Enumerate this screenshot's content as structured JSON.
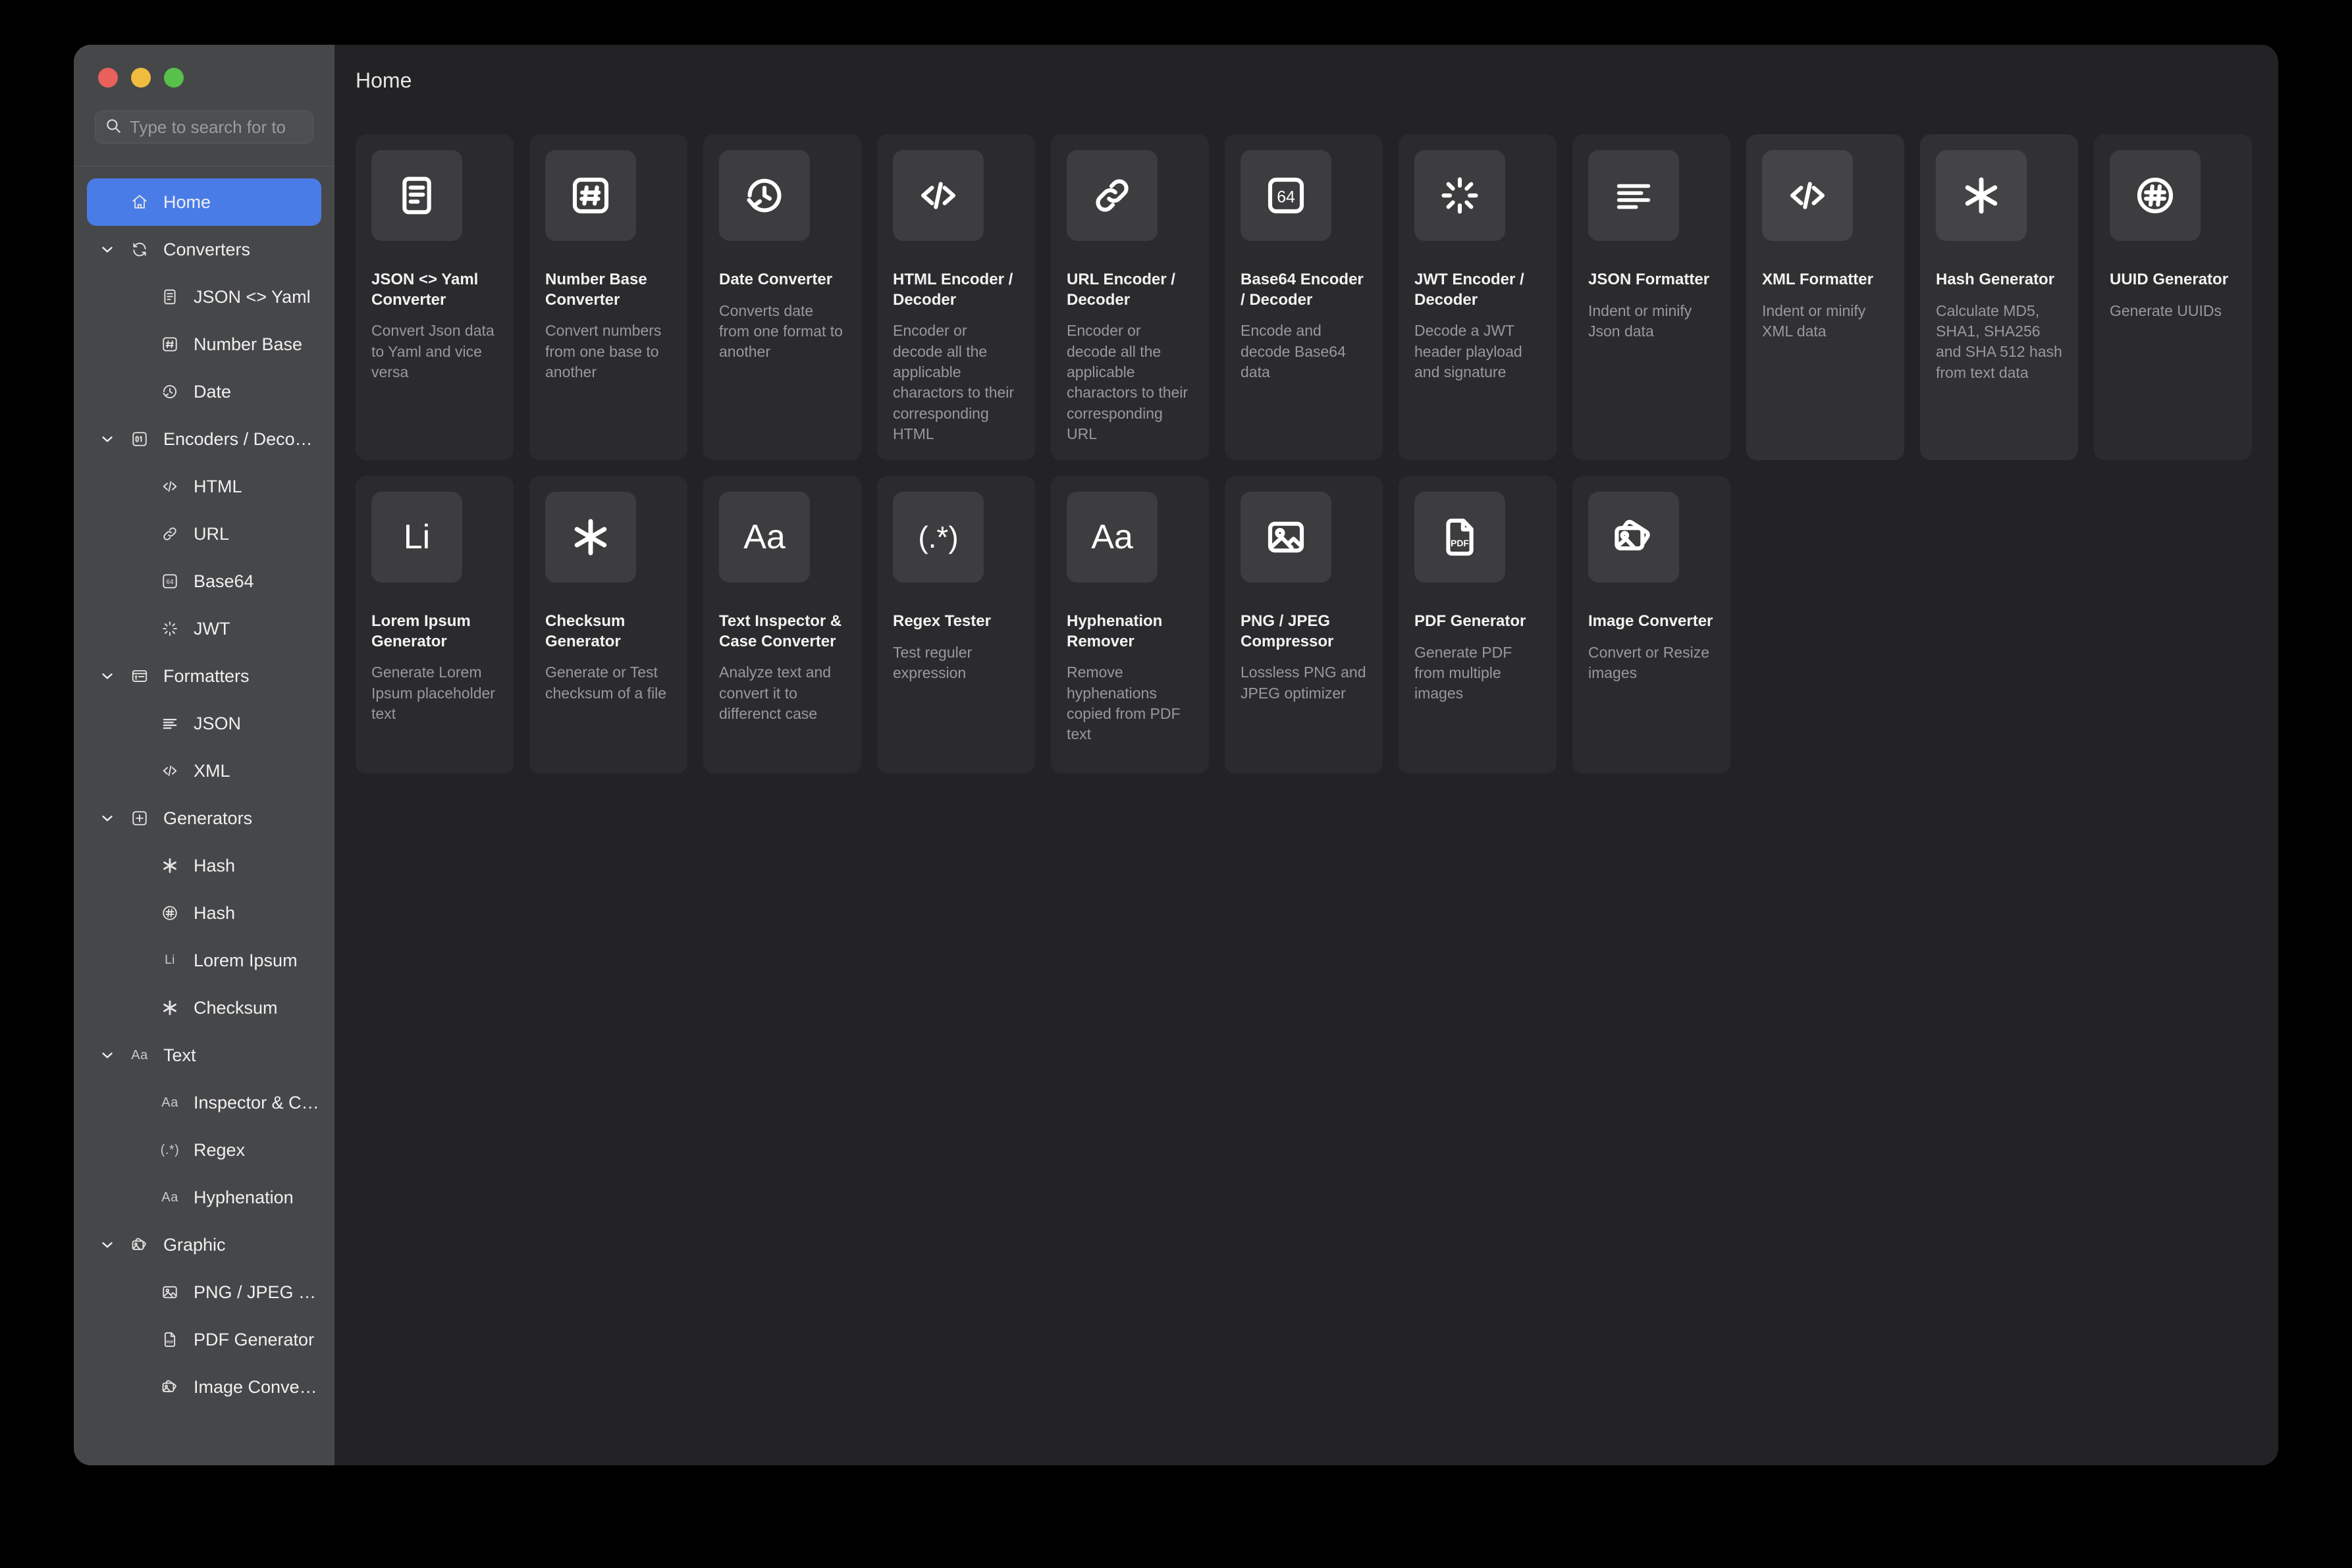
{
  "window": {
    "traffic_lights": [
      "close",
      "minimize",
      "maximize"
    ],
    "colors": {
      "accent": "#4a7ce8",
      "sidebar_bg": "#464749",
      "main_bg": "#232325",
      "card_bg": "#2b2b2d",
      "card_hover_bg": "#313133",
      "icon_tile_bg": "#3d3d3f",
      "close": "#e8615a",
      "minimize": "#f0bc3f",
      "maximize": "#57c14b"
    }
  },
  "search": {
    "placeholder": "Type to search for to",
    "value": "",
    "icon": "search-icon"
  },
  "sidebar": {
    "items": [
      {
        "label": "Home",
        "icon": "home-icon",
        "level": 0,
        "active": true,
        "expandable": false
      },
      {
        "label": "Converters",
        "icon": "refresh-icon",
        "level": 0,
        "active": false,
        "expandable": true,
        "expanded": true
      },
      {
        "label": "JSON <> Yaml",
        "icon": "document-icon",
        "level": 1,
        "active": false,
        "expandable": false
      },
      {
        "label": "Number Base",
        "icon": "hash-box-icon",
        "level": 1,
        "active": false,
        "expandable": false
      },
      {
        "label": "Date",
        "icon": "clock-rotate-icon",
        "level": 1,
        "active": false,
        "expandable": false
      },
      {
        "label": "Encoders / Decoders",
        "icon": "binary-box-icon",
        "level": 0,
        "active": false,
        "expandable": true,
        "expanded": true
      },
      {
        "label": "HTML",
        "icon": "code-icon",
        "level": 1,
        "active": false,
        "expandable": false
      },
      {
        "label": "URL",
        "icon": "link-icon",
        "level": 1,
        "active": false,
        "expandable": false
      },
      {
        "label": "Base64",
        "icon": "base64-box-icon",
        "level": 1,
        "active": false,
        "expandable": false
      },
      {
        "label": "JWT",
        "icon": "spinner-icon",
        "level": 1,
        "active": false,
        "expandable": false
      },
      {
        "label": "Formatters",
        "icon": "panel-list-icon",
        "level": 0,
        "active": false,
        "expandable": true,
        "expanded": true
      },
      {
        "label": "JSON",
        "icon": "align-left-icon",
        "level": 1,
        "active": false,
        "expandable": false
      },
      {
        "label": "XML",
        "icon": "code-icon",
        "level": 1,
        "active": false,
        "expandable": false
      },
      {
        "label": "Generators",
        "icon": "plus-box-icon",
        "level": 0,
        "active": false,
        "expandable": true,
        "expanded": true
      },
      {
        "label": "Hash",
        "icon": "asterisk-icon",
        "level": 1,
        "active": false,
        "expandable": false
      },
      {
        "label": "Hash",
        "icon": "hash-circle-icon",
        "level": 1,
        "active": false,
        "expandable": false
      },
      {
        "label": "Lorem Ipsum",
        "icon": "li-text-icon",
        "level": 1,
        "active": false,
        "expandable": false
      },
      {
        "label": "Checksum",
        "icon": "asterisk-icon",
        "level": 1,
        "active": false,
        "expandable": false
      },
      {
        "label": "Text",
        "icon": "aa-text-icon",
        "level": 0,
        "active": false,
        "expandable": true,
        "expanded": true
      },
      {
        "label": "Inspector & Case C...",
        "icon": "aa-text-icon",
        "level": 1,
        "active": false,
        "expandable": false
      },
      {
        "label": "Regex",
        "icon": "regex-icon",
        "level": 1,
        "active": false,
        "expandable": false
      },
      {
        "label": "Hyphenation",
        "icon": "aa-text-icon",
        "level": 1,
        "active": false,
        "expandable": false
      },
      {
        "label": "Graphic",
        "icon": "images-icon",
        "level": 0,
        "active": false,
        "expandable": true,
        "expanded": true
      },
      {
        "label": "PNG / JPEG Compr...",
        "icon": "image-icon",
        "level": 1,
        "active": false,
        "expandable": false
      },
      {
        "label": "PDF Generator",
        "icon": "pdf-file-icon",
        "level": 1,
        "active": false,
        "expandable": false
      },
      {
        "label": "Image Converter",
        "icon": "images-icon",
        "level": 1,
        "active": false,
        "expandable": false
      }
    ]
  },
  "main": {
    "title": "Home",
    "cards": [
      {
        "title": "JSON <> Yaml Converter",
        "desc": "Convert Json data to Yaml and vice versa",
        "icon": "document-icon",
        "hover": false
      },
      {
        "title": "Number Base Converter",
        "desc": "Convert numbers from one base to another",
        "icon": "hash-box-icon",
        "hover": false
      },
      {
        "title": "Date Converter",
        "desc": "Converts date from one format to another",
        "icon": "clock-rotate-icon",
        "hover": false
      },
      {
        "title": "HTML Encoder / Decoder",
        "desc": "Encoder or decode all the applicable charactors to their corresponding HTML",
        "icon": "code-icon",
        "hover": false
      },
      {
        "title": "URL Encoder / Decoder",
        "desc": "Encoder or decode all the applicable charactors to their corresponding URL",
        "icon": "link-icon",
        "hover": false
      },
      {
        "title": "Base64 Encoder / Decoder",
        "desc": "Encode and decode Base64 data",
        "icon": "base64-box-icon",
        "hover": false
      },
      {
        "title": "JWT Encoder / Decoder",
        "desc": "Decode a JWT header playload and signature",
        "icon": "spinner-icon",
        "hover": false
      },
      {
        "title": "JSON Formatter",
        "desc": "Indent or minify Json data",
        "icon": "align-left-icon",
        "hover": false
      },
      {
        "title": "XML Formatter",
        "desc": "Indent or minify XML data",
        "icon": "code-icon",
        "hover": true
      },
      {
        "title": "Hash Generator",
        "desc": "Calculate MD5, SHA1, SHA256 and SHA 512 hash from text data",
        "icon": "asterisk-icon",
        "hover": true
      },
      {
        "title": "UUID Generator",
        "desc": "Generate UUIDs",
        "icon": "hash-circle-icon",
        "hover": false
      },
      {
        "title": "Lorem Ipsum Generator",
        "desc": "Generate Lorem Ipsum placeholder text",
        "icon": "li-text-icon",
        "hover": false
      },
      {
        "title": "Checksum Generator",
        "desc": "Generate or Test checksum of a file",
        "icon": "asterisk-icon",
        "hover": false
      },
      {
        "title": "Text Inspector & Case Converter",
        "desc": "Analyze text and convert it to differenct case",
        "icon": "aa-text-icon",
        "hover": false
      },
      {
        "title": "Regex Tester",
        "desc": "Test reguler expression",
        "icon": "regex-icon",
        "hover": false
      },
      {
        "title": "Hyphenation Remover",
        "desc": "Remove hyphenations copied from PDF text",
        "icon": "aa-text-icon",
        "hover": false
      },
      {
        "title": "PNG / JPEG Compressor",
        "desc": "Lossless PNG and JPEG optimizer",
        "icon": "image-icon",
        "hover": false
      },
      {
        "title": "PDF Generator",
        "desc": "Generate PDF from multiple images",
        "icon": "pdf-file-icon",
        "hover": false
      },
      {
        "title": "Image Converter",
        "desc": "Convert or Resize images",
        "icon": "images-icon",
        "hover": false
      }
    ]
  }
}
